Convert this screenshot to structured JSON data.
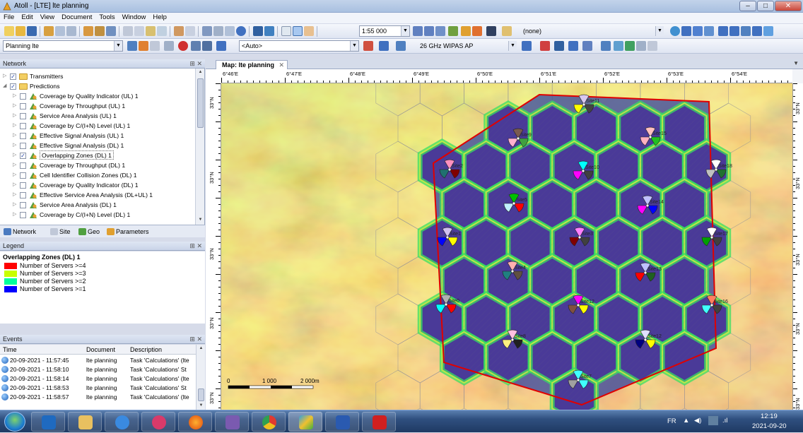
{
  "window": {
    "title": "Atoll - [LTE] lte planning",
    "min": "–",
    "max": "□",
    "close": "✕"
  },
  "menu": [
    "File",
    "Edit",
    "View",
    "Document",
    "Tools",
    "Window",
    "Help"
  ],
  "toolbar1": {
    "scale": "1:55 000",
    "layer": "(none)"
  },
  "toolbar2": {
    "project": "Planning lte",
    "auto": "<Auto>",
    "band": "26 GHz WIPAS AP"
  },
  "network_panel": {
    "title": "Network",
    "tree": [
      {
        "label": "Transmitters",
        "level": 1,
        "checked": true,
        "icon": "folder"
      },
      {
        "label": "Predictions",
        "level": 1,
        "checked": true,
        "icon": "folder"
      },
      {
        "label": "Coverage by Quality Indicator (UL) 1",
        "level": 2,
        "checked": false
      },
      {
        "label": "Coverage by Throughput (UL) 1",
        "level": 2,
        "checked": false
      },
      {
        "label": "Service Area Analysis (UL) 1",
        "level": 2,
        "checked": false
      },
      {
        "label": "Coverage by C/(I+N) Level (UL) 1",
        "level": 2,
        "checked": false
      },
      {
        "label": "Effective Signal Analysis (UL) 1",
        "level": 2,
        "checked": false
      },
      {
        "label": "Effective Signal Analysis (DL) 1",
        "level": 2,
        "checked": false
      },
      {
        "label": "Overlapping Zones (DL) 1",
        "level": 2,
        "checked": true
      },
      {
        "label": "Coverage by Throughput (DL) 1",
        "level": 2,
        "checked": false
      },
      {
        "label": "Cell Identifier Collision Zones (DL) 1",
        "level": 2,
        "checked": false
      },
      {
        "label": "Coverage by Quality Indicator (DL) 1",
        "level": 2,
        "checked": false
      },
      {
        "label": "Effective Service Area Analysis (DL+UL) 1",
        "level": 2,
        "checked": false
      },
      {
        "label": "Service Area Analysis (DL) 1",
        "level": 2,
        "checked": false
      },
      {
        "label": "Coverage by C/(I+N) Level (DL) 1",
        "level": 2,
        "checked": false
      }
    ],
    "tabs": [
      "Network",
      "Site",
      "Geo",
      "Parameters"
    ]
  },
  "legend_panel": {
    "title": "Legend",
    "heading": "Overlapping Zones (DL) 1",
    "items": [
      {
        "label": "Number of Servers >=4",
        "color": "#ff0000"
      },
      {
        "label": "Number of Servers >=3",
        "color": "#c8ff00"
      },
      {
        "label": "Number of Servers >=2",
        "color": "#00ff9c"
      },
      {
        "label": "Number of Servers >=1",
        "color": "#0000ff"
      }
    ]
  },
  "events_panel": {
    "title": "Events",
    "columns": [
      "Time",
      "Document",
      "Description"
    ],
    "rows": [
      {
        "time": "20-09-2021 - 11:57:45",
        "doc": "lte planning",
        "desc": "Task 'Calculations' (lte"
      },
      {
        "time": "20-09-2021 - 11:58:10",
        "doc": "lte planning",
        "desc": "Task 'Calculations' St"
      },
      {
        "time": "20-09-2021 - 11:58:14",
        "doc": "lte planning",
        "desc": "Task 'Calculations' (lte"
      },
      {
        "time": "20-09-2021 - 11:58:53",
        "doc": "lte planning",
        "desc": "Task 'Calculations' St"
      },
      {
        "time": "20-09-2021 - 11:58:57",
        "doc": "lte planning",
        "desc": "Task 'Calculations' (lte"
      }
    ]
  },
  "map": {
    "tab": "Map: lte planning",
    "lon_labels": [
      "6°46'E",
      "6°47'E",
      "6°48'E",
      "6°49'E",
      "6°50'E",
      "6°51'E",
      "6°52'E",
      "6°53'E",
      "6°54'E"
    ],
    "lat_labels": [
      "33°N",
      "33°N",
      "33°N",
      "33°N",
      "33°N"
    ],
    "scalebar": {
      "zero": "0",
      "mid": "1 000",
      "end": "2 000m"
    },
    "sites": [
      {
        "label": "Site11",
        "c": [
          "#d8c8f0",
          "#ffff00",
          "#444444"
        ]
      },
      {
        "label": "Site9",
        "c": [
          "#7a5a50",
          "#ffb0d0",
          "#40a040"
        ]
      },
      {
        "label": "Site15",
        "c": [
          "#ffc0c0",
          "#ffb0c0",
          "#20c020"
        ]
      },
      {
        "label": "Site2",
        "c": [
          "#ff90c0",
          "#207070",
          "#800000"
        ]
      },
      {
        "label": "Site10",
        "c": [
          "#00ffff",
          "#ff00ff",
          "#404040"
        ]
      },
      {
        "label": "Site18",
        "c": [
          "#ffffff",
          "#c0c0c0",
          "#207030"
        ]
      },
      {
        "label": "Site5",
        "c": [
          "#00c000",
          "#c0f0ff",
          "#ff0000"
        ]
      },
      {
        "label": "Site14",
        "c": [
          "#c0c0ff",
          "#ff00ff",
          "#0000ff"
        ]
      },
      {
        "label": "Site1",
        "c": [
          "#d0c0f0",
          "#0000ff",
          "#ffff00"
        ]
      },
      {
        "label": "Site3",
        "c": [
          "#ff80ff",
          "#800000",
          "#404040"
        ]
      },
      {
        "label": "Site17",
        "c": [
          "#ffffff",
          "#00a000",
          "#404040"
        ]
      },
      {
        "label": "Site4",
        "c": [
          "#ffb0b0",
          "#208080",
          "#605040"
        ]
      },
      {
        "label": "Site13",
        "c": [
          "#c0c0ff",
          "#ff0000",
          "#206020"
        ]
      },
      {
        "label": "Site0",
        "c": [
          "#b0b0b0",
          "#00ffff",
          "#ff0000"
        ]
      },
      {
        "label": "Site12",
        "c": [
          "#ff00ff",
          "#805040",
          "#ffff00"
        ]
      },
      {
        "label": "Site16",
        "c": [
          "#ff8060",
          "#40ffff",
          "#404040"
        ]
      },
      {
        "label": "Site8",
        "c": [
          "#ffc0e0",
          "#fff080",
          "#202020"
        ]
      },
      {
        "label": "Site12",
        "c": [
          "#e0e0ff",
          "#000080",
          "#ffff00"
        ]
      },
      {
        "label": "Site7",
        "c": [
          "#40ffff",
          "#a0a0a0",
          "#40ffff"
        ]
      }
    ]
  },
  "taskbar": {
    "lang": "FR",
    "time": "12:19",
    "date": "2021-09-20"
  }
}
